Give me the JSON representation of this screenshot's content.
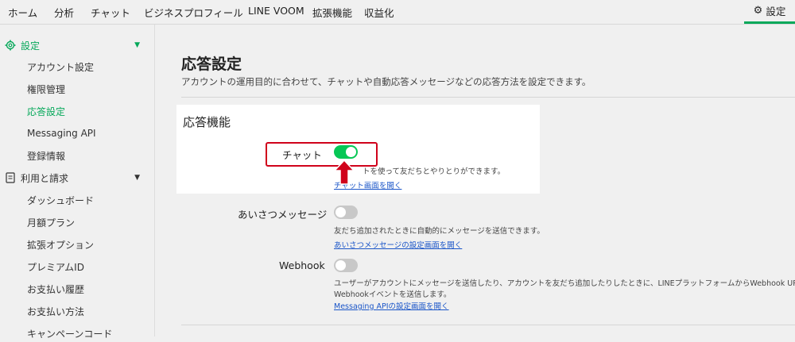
{
  "topnav": {
    "items": [
      "ホーム",
      "分析",
      "チャット",
      "ビジネスプロフィール",
      "LINE VOOM",
      "拡張機能",
      "収益化"
    ],
    "settings_label": "設定",
    "settings_icon": "gear-icon"
  },
  "sidebar": {
    "settings_header": "設定",
    "settings_items": [
      "アカウント設定",
      "権限管理",
      "応答設定",
      "Messaging API",
      "登録情報"
    ],
    "active_item": "応答設定",
    "billing_header": "利用と請求",
    "billing_items": [
      "ダッシュボード",
      "月額プラン",
      "拡張オプション",
      "プレミアムID",
      "お支払い履歴",
      "お支払い方法",
      "キャンペーンコード"
    ]
  },
  "main": {
    "title": "応答設定",
    "description": "アカウントの運用目的に合わせて、チャットや自動応答メッセージなどの応答方法を設定できます。",
    "section_title": "応答機能",
    "chat": {
      "label": "チャット",
      "enabled": true,
      "desc": "トを使って友だちとやりとりができます。",
      "link": "チャット画面を開く"
    },
    "greeting": {
      "label": "あいさつメッセージ",
      "enabled": false,
      "desc": "友だち追加されたときに自動的にメッセージを送信できます。",
      "link": "あいさつメッセージの設定画面を開く"
    },
    "webhook": {
      "label": "Webhook",
      "enabled": false,
      "desc_line1": "ユーザーがアカウントにメッセージを送信したり、アカウントを友だち追加したりしたときに、LINEプラットフォームからWebhook URLに",
      "desc_line2": "Webhookイベントを送信します。",
      "link": "Messaging APIの設定画面を開く"
    }
  },
  "colors": {
    "accent_green": "#06a85a",
    "toggle_on": "#06c755",
    "annotation_red": "#d0021b",
    "link_blue": "#1a55c8"
  }
}
